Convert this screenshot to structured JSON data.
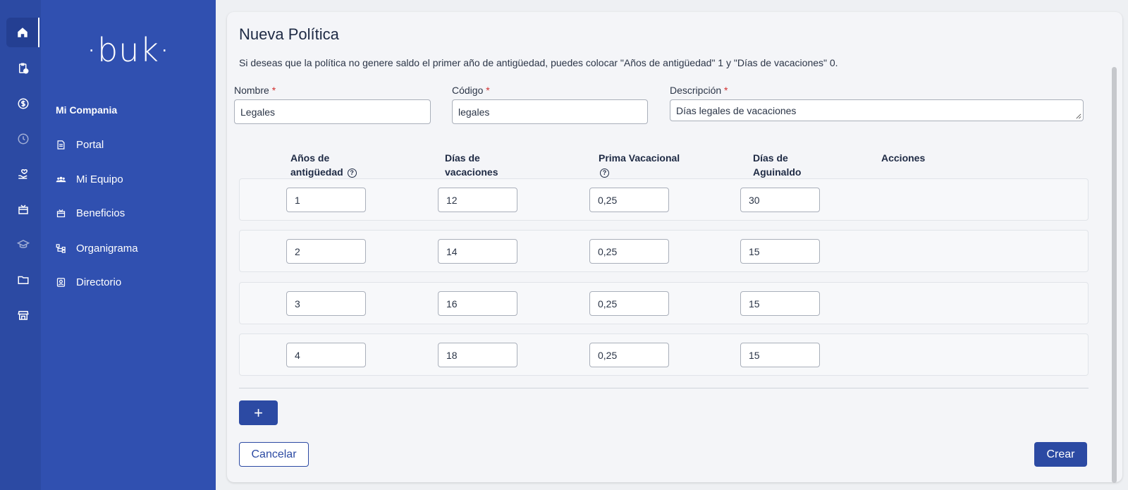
{
  "brand": {
    "logo_text": "·buk·",
    "accent": "#2c4aa3",
    "sidebar_bg": "#3050b0"
  },
  "rail_icons": [
    "home-icon",
    "clipboard-clock-icon",
    "dollar-circle-icon",
    "clock-icon",
    "hand-heart-icon",
    "gift-icon",
    "graduation-cap-icon",
    "folder-icon",
    "store-icon"
  ],
  "sidebar": {
    "company": "Mi Compania",
    "items": [
      {
        "label": "Portal",
        "icon": "document-icon"
      },
      {
        "label": "Mi Equipo",
        "icon": "team-icon"
      },
      {
        "label": "Beneficios",
        "icon": "gift-icon"
      },
      {
        "label": "Organigrama",
        "icon": "org-chart-icon"
      },
      {
        "label": "Directorio",
        "icon": "contact-card-icon"
      }
    ]
  },
  "form": {
    "title": "Nueva Política",
    "hint": "Si deseas que la política no genere saldo el primer año de antigüedad, puedes colocar \"Años de antigüedad\" 1 y \"Días de vacaciones\" 0.",
    "nombre": {
      "label": "Nombre",
      "value": "Legales"
    },
    "codigo": {
      "label": "Código",
      "value": "legales"
    },
    "descripcion": {
      "label": "Descripción",
      "value": "Días legales de vacaciones"
    },
    "required_mark": "*"
  },
  "table": {
    "headers": {
      "antiguedad_1": "Años de",
      "antiguedad_2": "antigüedad",
      "vacaciones_1": "Días de",
      "vacaciones_2": "vacaciones",
      "prima": "Prima Vacacional",
      "aguinaldo_1": "Días de",
      "aguinaldo_2": "Aguinaldo",
      "acciones": "Acciones",
      "help_glyph": "?"
    },
    "rows": [
      {
        "antiguedad": "1",
        "vacaciones": "12",
        "prima": "0,25",
        "aguinaldo": "30"
      },
      {
        "antiguedad": "2",
        "vacaciones": "14",
        "prima": "0,25",
        "aguinaldo": "15"
      },
      {
        "antiguedad": "3",
        "vacaciones": "16",
        "prima": "0,25",
        "aguinaldo": "15"
      },
      {
        "antiguedad": "4",
        "vacaciones": "18",
        "prima": "0,25",
        "aguinaldo": "15"
      }
    ]
  },
  "actions": {
    "add": "+",
    "cancel": "Cancelar",
    "create": "Crear"
  }
}
